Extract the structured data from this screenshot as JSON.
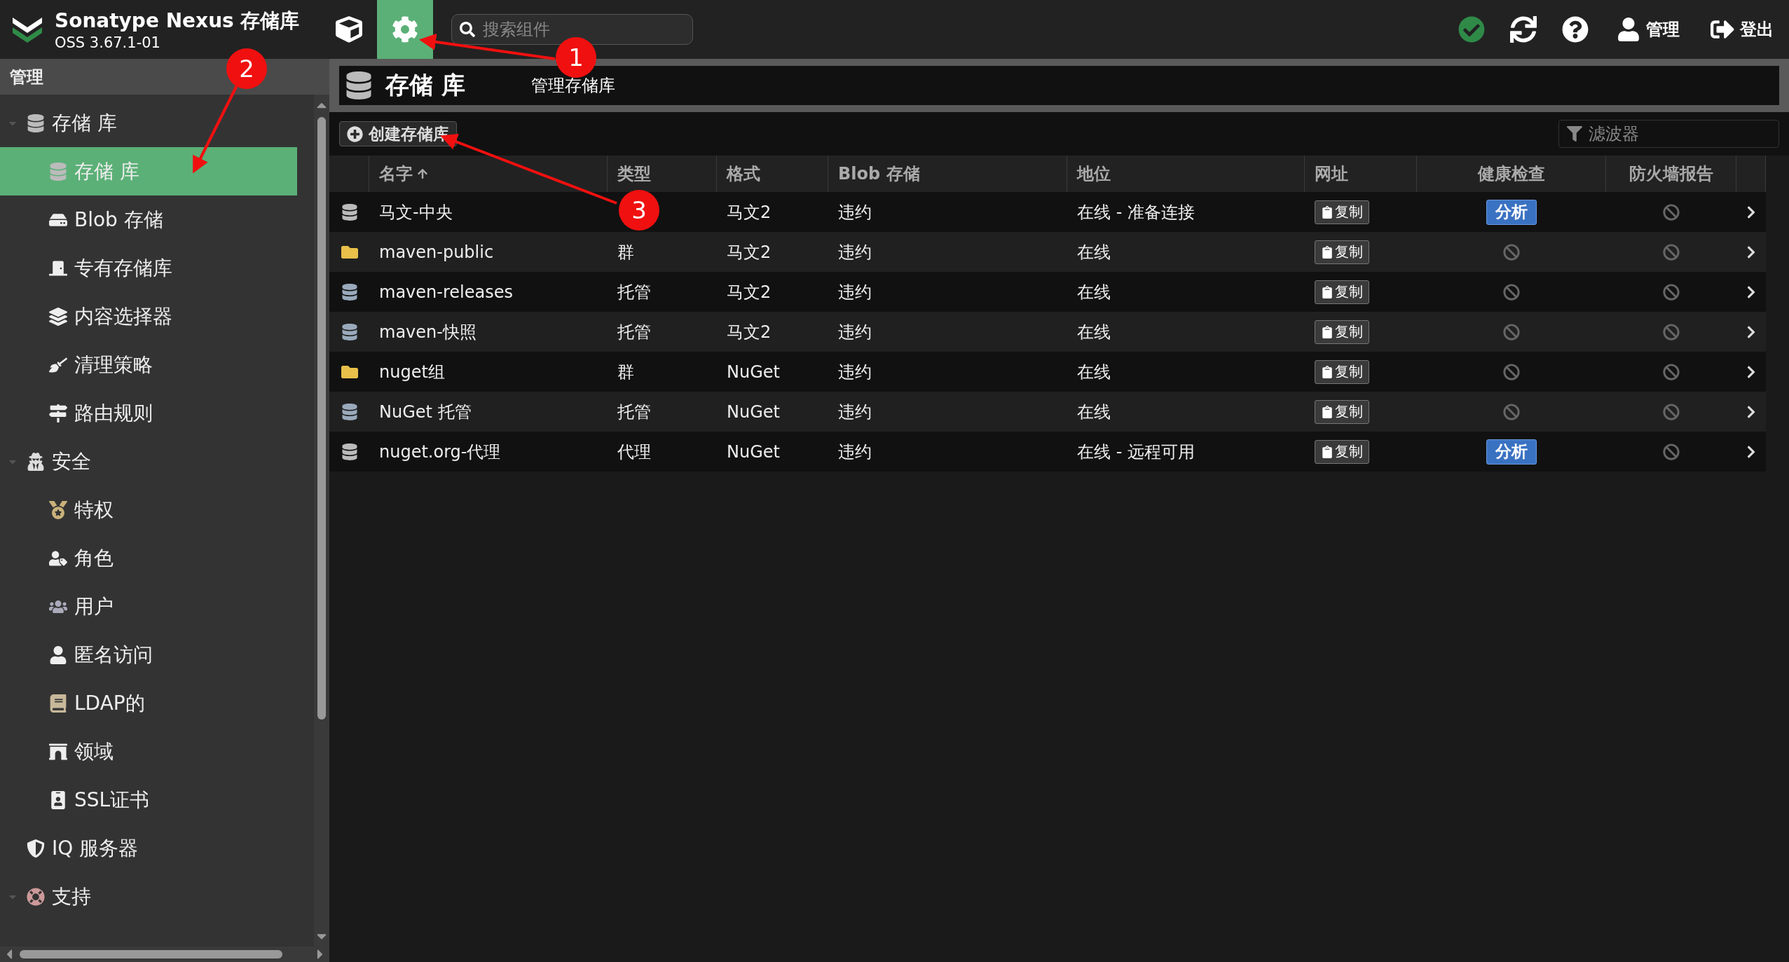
{
  "header": {
    "product": "Sonatype Nexus 存储库",
    "version": "OSS 3.67.1-01",
    "nav_buttons": [
      {
        "kind": "browse",
        "selected": false
      },
      {
        "kind": "admin",
        "selected": true
      }
    ],
    "search_placeholder": "搜索组件",
    "status_ok": true,
    "user_label": "管理",
    "logout_label": "登出"
  },
  "sidebar": {
    "title": "管理",
    "items": [
      {
        "label": "存储 库",
        "expanded": true,
        "children": [
          {
            "label": "存储 库",
            "selected": true
          },
          {
            "label": "Blob 存储",
            "selected": false
          },
          {
            "label": "专有存储库",
            "selected": false
          },
          {
            "label": "内容选择器",
            "selected": false
          },
          {
            "label": "清理策略",
            "selected": false
          },
          {
            "label": "路由规则",
            "selected": false
          }
        ]
      },
      {
        "label": "安全",
        "expanded": true,
        "children": [
          {
            "label": "特权",
            "selected": false
          },
          {
            "label": "角色",
            "selected": false
          },
          {
            "label": "用户",
            "selected": false
          },
          {
            "label": "匿名访问",
            "selected": false
          },
          {
            "label": "LDAP的",
            "selected": false
          },
          {
            "label": "领域",
            "selected": false
          },
          {
            "label": "SSL证书",
            "selected": false
          }
        ]
      },
      {
        "label": "IQ 服务器"
      },
      {
        "label": "支持",
        "expanded": true
      }
    ]
  },
  "page": {
    "title": "存储 库",
    "subtitle": "管理存储库"
  },
  "toolbar": {
    "create_button": "创建存储库",
    "filter_placeholder": "滤波器"
  },
  "table": {
    "columns": [
      {
        "label": "名字",
        "sorted": true
      },
      {
        "label": "类型",
        "sorted": false
      },
      {
        "label": "格式",
        "sorted": false
      },
      {
        "label": "Blob 存储",
        "sorted": false
      },
      {
        "label": "地位",
        "sorted": false
      },
      {
        "label": "网址",
        "sorted": false
      },
      {
        "label": "健康检查",
        "sorted": false
      },
      {
        "label": "防火墙报告",
        "sorted": false
      }
    ],
    "rows": [
      {
        "kind": "proxy",
        "name": "马文-中央",
        "format": "马文2",
        "blob": "违约",
        "status": "在线 - 准备连接",
        "copy": "复制",
        "health": "分析"
      },
      {
        "kind": "group",
        "name": "maven-public",
        "type": "群",
        "format": "马文2",
        "blob": "违约",
        "status": "在线",
        "copy": "复制"
      },
      {
        "kind": "hosted",
        "name": "maven-releases",
        "type": "托管",
        "format": "马文2",
        "blob": "违约",
        "status": "在线",
        "copy": "复制"
      },
      {
        "kind": "hosted",
        "name": "maven-快照",
        "type": "托管",
        "format": "马文2",
        "blob": "违约",
        "status": "在线",
        "copy": "复制"
      },
      {
        "kind": "group",
        "name": "nuget组",
        "type": "群",
        "format": "NuGet",
        "blob": "违约",
        "status": "在线",
        "copy": "复制"
      },
      {
        "kind": "hosted",
        "name": "NuGet 托管",
        "type": "托管",
        "format": "NuGet",
        "blob": "违约",
        "status": "在线",
        "copy": "复制"
      },
      {
        "kind": "proxy",
        "name": "nuget.org-代理",
        "type": "代理",
        "format": "NuGet",
        "blob": "违约",
        "status": "在线 - 远程可用",
        "copy": "复制",
        "health": "分析"
      }
    ]
  },
  "annotations": [
    {
      "number": "1"
    },
    {
      "number": "2"
    },
    {
      "number": "3"
    }
  ]
}
